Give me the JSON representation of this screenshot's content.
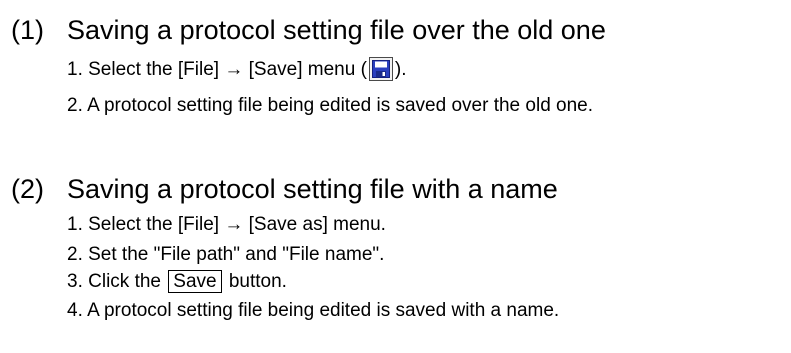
{
  "section1": {
    "number": "(1)",
    "title": "Saving a protocol setting file over the old one",
    "steps": {
      "s1_before": "1. Select the [File] → [Save] menu (",
      "s1_icon": "save-icon",
      "s1_after": ").",
      "s2": "2. A protocol setting file being edited is saved over the old one."
    }
  },
  "section2": {
    "number": "(2)",
    "title": "Saving a protocol setting file with a name",
    "steps": {
      "s1": "1. Select the [File] → [Save as] menu.",
      "s2": "2. Set the \"File path\" and \"File name\".",
      "s3_before": "3. Click the",
      "s3_button": "Save",
      "s3_after": "button.",
      "s4": "4. A protocol setting file being edited is saved with a name."
    }
  },
  "colors": {
    "text": "#000000",
    "icon_blue": "#2a3fbf",
    "icon_frame": "#f2f2f2"
  }
}
